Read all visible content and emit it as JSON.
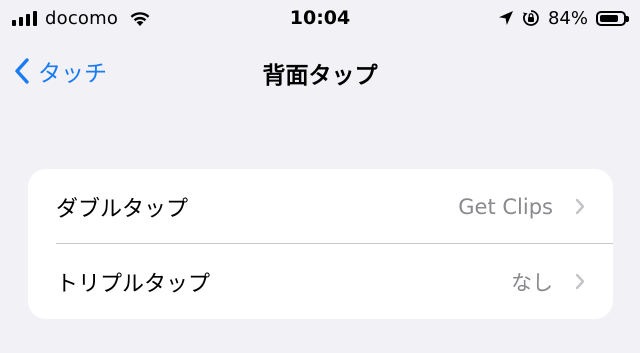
{
  "status_bar": {
    "carrier": "docomo",
    "time": "10:04",
    "battery_percent": "84%",
    "battery_level": 0.84,
    "icons": [
      "cellular-signal-icon",
      "wifi-icon",
      "location-arrow-icon",
      "orientation-lock-icon",
      "battery-icon"
    ]
  },
  "nav": {
    "back_label": "タッチ",
    "title": "背面タップ"
  },
  "settings": {
    "rows": [
      {
        "label": "ダブルタップ",
        "value": "Get Clips"
      },
      {
        "label": "トリプルタップ",
        "value": "なし"
      }
    ]
  },
  "colors": {
    "background": "#f2f1f6",
    "card": "#ffffff",
    "accent": "#1a7cf5",
    "secondary_text": "#8a8a8e"
  }
}
